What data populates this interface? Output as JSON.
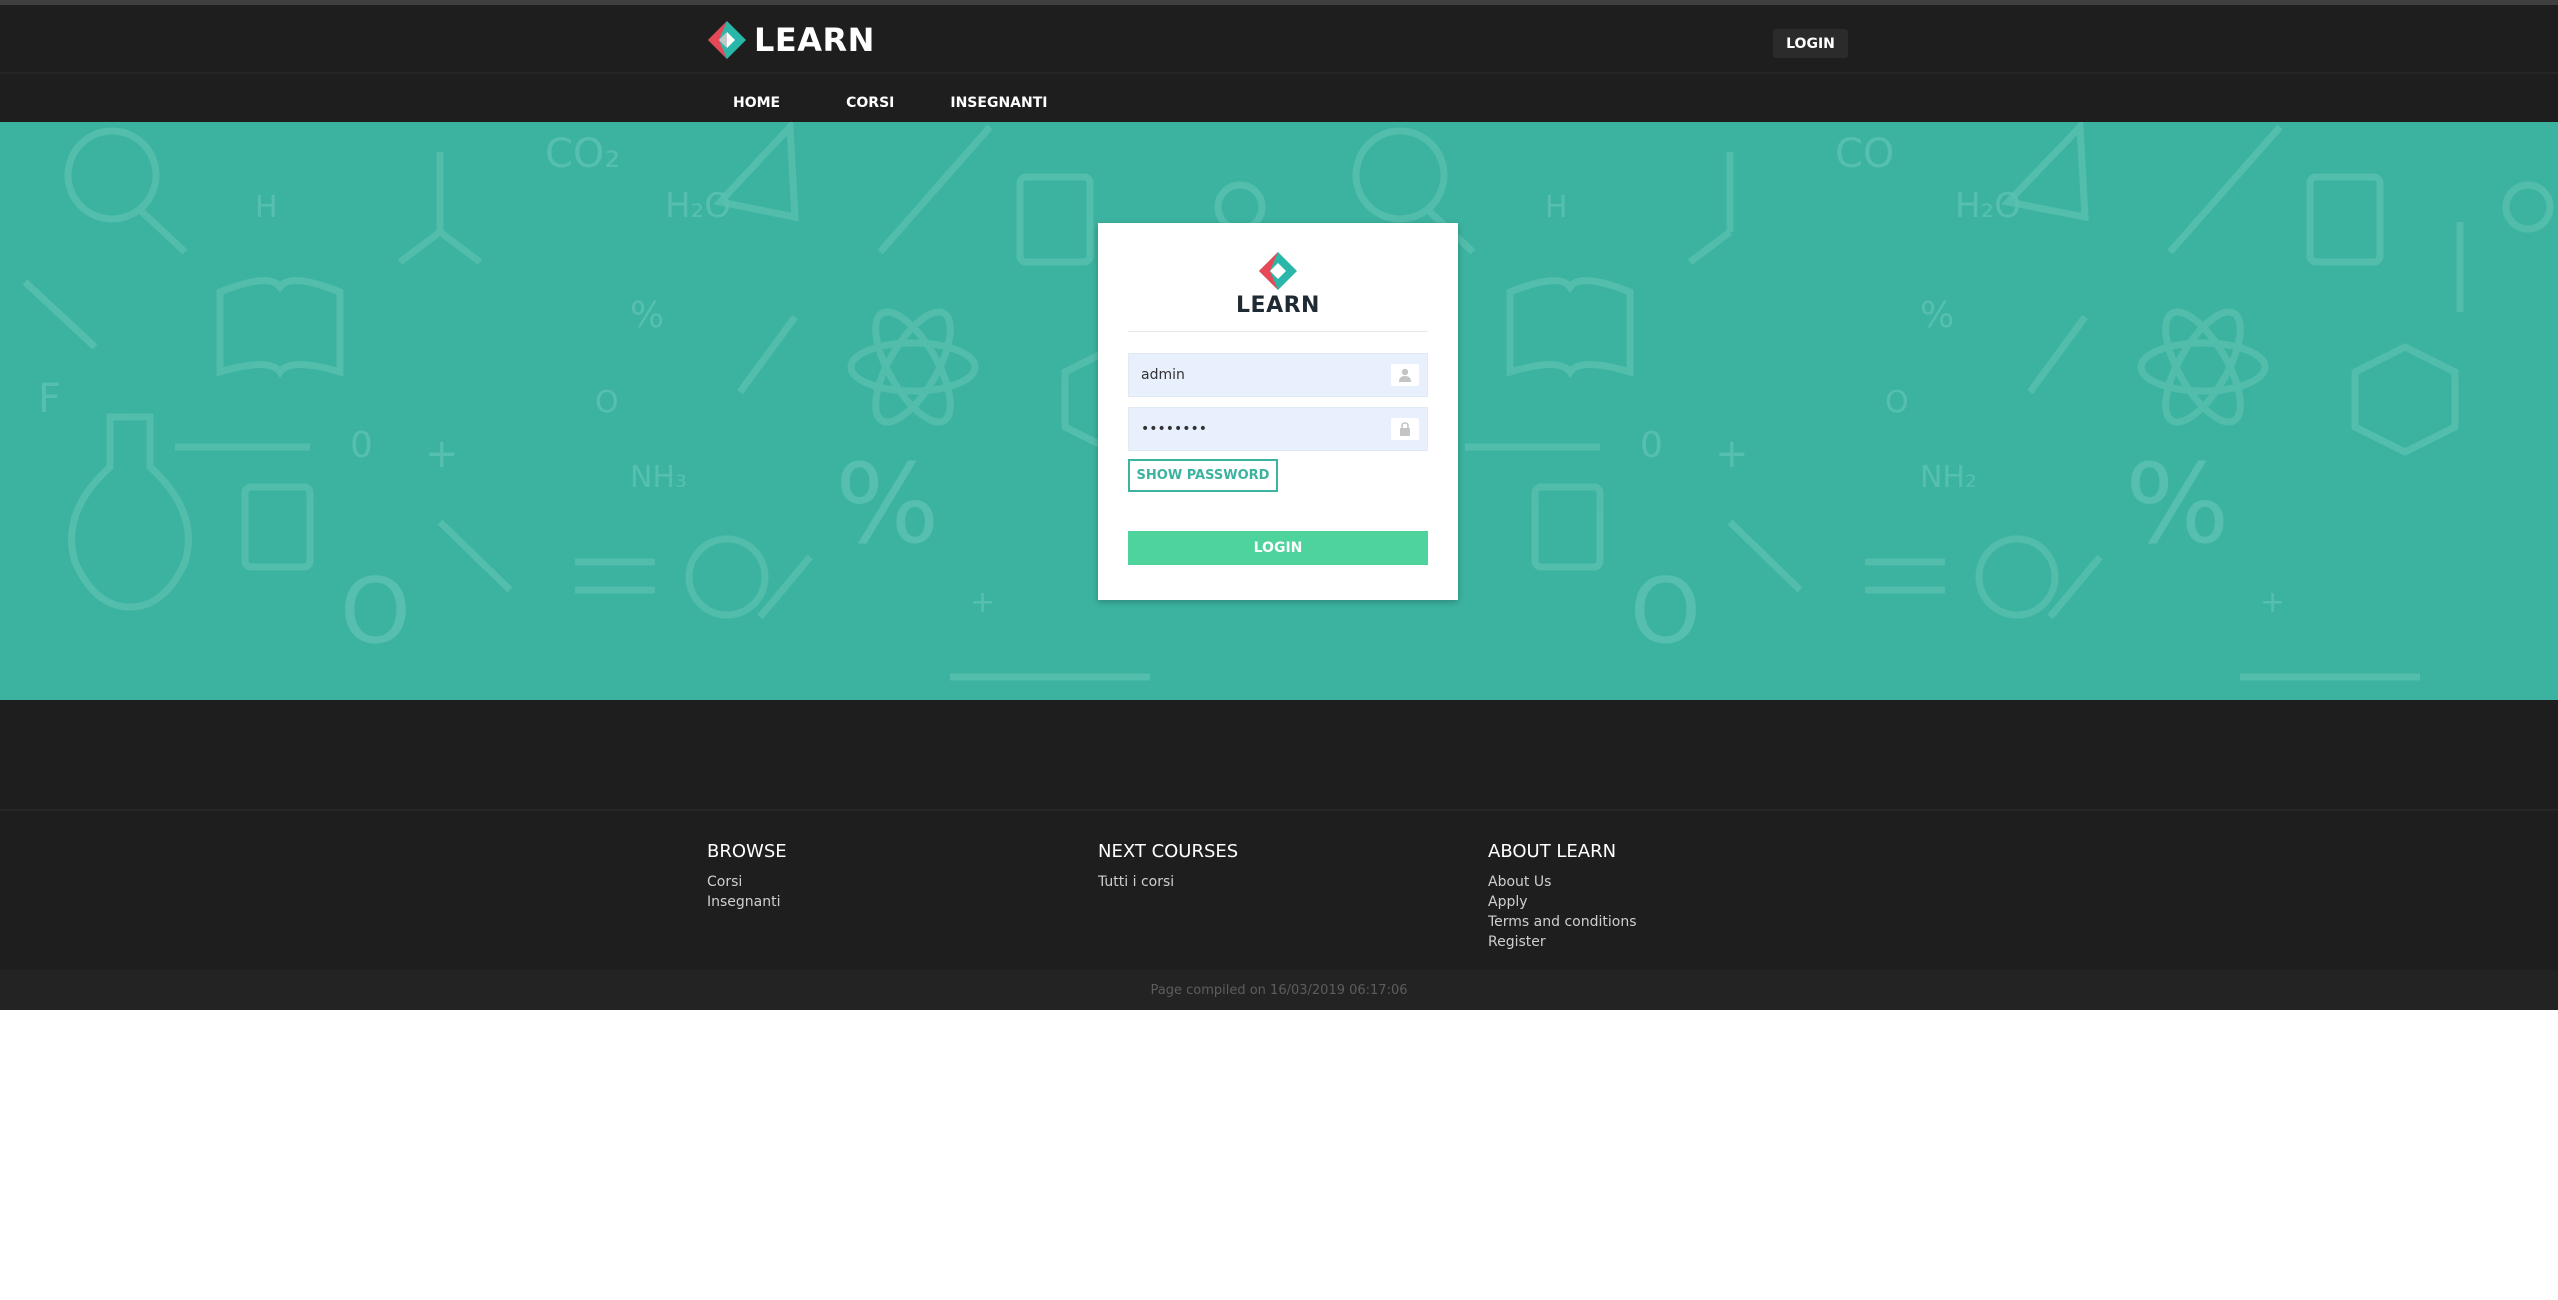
{
  "header": {
    "logo_text": "LEARN",
    "login_label": "LOGIN",
    "nav": [
      "HOME",
      "CORSI",
      "INSEGNANTI"
    ]
  },
  "hero": {
    "doodle_labels": [
      "CO₂",
      "H₂O",
      "H",
      "%",
      "0",
      "+",
      "NH₃",
      "O₂",
      "F"
    ]
  },
  "login_card": {
    "logo_text": "LEARN",
    "username_value": "admin",
    "password_mask": "••••••••",
    "show_password_label": "SHOW PASSWORD",
    "submit_label": "LOGIN"
  },
  "footer": {
    "columns": [
      {
        "title": "BROWSE",
        "links": [
          "Corsi",
          "Insegnanti"
        ]
      },
      {
        "title": "NEXT COURSES",
        "links": [
          "Tutti i corsi"
        ]
      },
      {
        "title": "ABOUT LEARN",
        "links": [
          "About Us",
          "Apply",
          "Terms and conditions",
          "Register"
        ]
      }
    ],
    "compiled_text": "Page compiled on 16/03/2019 06:17:06"
  },
  "colors": {
    "header_bg": "#1e1e1e",
    "hero_bg": "#3cb3a0",
    "accent": "#3cb3a0",
    "button_green": "#4fd39c",
    "logo_red": "#e84855",
    "logo_teal": "#2ab7a9"
  },
  "icons": {
    "username_field": "user-icon",
    "password_field": "lock-icon",
    "logo": "learn-logo-icon"
  }
}
